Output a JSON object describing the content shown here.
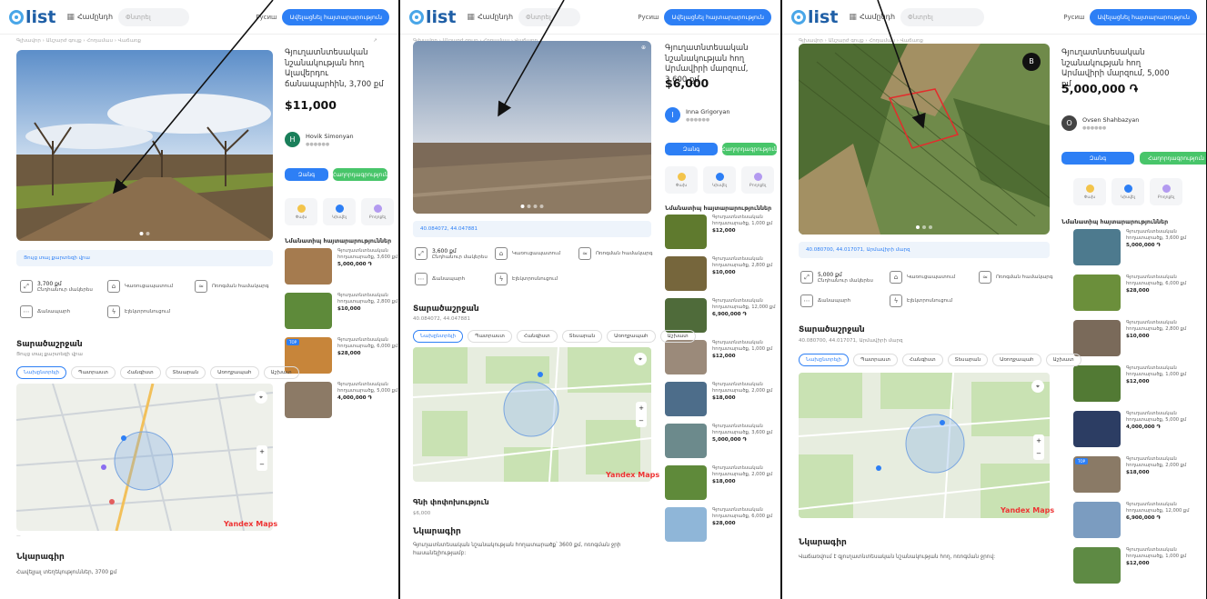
{
  "header": {
    "logo": "list",
    "category": "Համընդհ",
    "search_placeholder": "Փնտրել",
    "lang": "Русиш",
    "post_button": "Ավելացնել հայտարարություն"
  },
  "listings": [
    {
      "title": "Գյուղատնտեսական նշանակության հող Ալավերդու ճանապարհին, 3,700 քմ",
      "price": "$11,000",
      "seller_name": "Hovik Simonyan",
      "seller_initial": "H",
      "seller_color": "#1a7f5a",
      "coords": "Ցույց տալ քարտեզի վրա",
      "size": "3,700 քմ",
      "description": "Հավելյալ տեղեկություններ, 3700 քմ",
      "tabs": [
        "Նախընտրելի",
        "Պատրաստ",
        "Հանգիստ",
        "Տեսարան",
        "Առողջապահ",
        "Աշխատ"
      ]
    },
    {
      "title": "Գյուղատնտեսական նշանակության հող Արմավիրի մարզում, 3,600 քմ",
      "price": "$6,000",
      "seller_name": "Inna Grigoryan",
      "seller_initial": "I",
      "seller_color": "#2d7ff5",
      "coords": "40.084072, 44.047881",
      "size": "3,600 քմ",
      "price_history": "Գնի փոփոխություն",
      "description": "Գյուղատնտեսական նշանակության հողատարածք՝ 3600 քմ, ոռոգման ջրի հասանելիությամբ:",
      "tabs": [
        "Նախընտրելի",
        "Պատրաստ",
        "Հանգիստ",
        "Տեսարան",
        "Առողջապահ",
        "Աշխատ"
      ]
    },
    {
      "title": "Գյուղատնտեսական նշանակության հող Արմավիրի մարզում, 5,000 քմ",
      "price": "5,000,000 ֏",
      "seller_name": "Ovsen Shahbazyan",
      "seller_initial": "O",
      "seller_color": "#444",
      "coords": "40.080700, 44.017071, Արմավիրի մարզ",
      "size": "5,000 քմ",
      "description": "Վաճառվում է գյուղատնտեսական նշանակության հող, ոռոգման ջրով:",
      "tabs": [
        "Նախընտրելի",
        "Պատրաստ",
        "Հանգիստ",
        "Տեսարան",
        "Առողջապահ",
        "Աշխատ"
      ]
    }
  ],
  "labels": {
    "call": "Զանգ",
    "message": "Հաղորդագրություն",
    "similar": "Նմանատիպ հայտարարություններ",
    "location": "Տարածաշրջան",
    "desc_title": "Նկարագիր",
    "map_brand": "Yandex Maps",
    "act_save": "Փախ",
    "act_share": "Կիսվել",
    "act_report": "Բողոքել",
    "feat_area": "Ընդհանուր մակերես",
    "feat_build": "Կառուցապատում",
    "feat_irrig": "Ոռոգման համակարգ",
    "feat_road": "Ճանապարհ",
    "feat_elec": "Էլեկտրոսնուցում"
  },
  "similar": [
    [
      "Գյուղատնտեսական հողատարածք, 3,600 քմ",
      "5,000,000 ֏"
    ],
    [
      "Գյուղատնտեսական հողատարածք, 2,800 քմ",
      "$10,000"
    ],
    [
      "Գյուղատնտեսական հողատարածք, 6,000 քմ",
      "$28,000"
    ],
    [
      "Գյուղատնտեսական հողատարածք, 5,000 քմ",
      "4,000,000 ֏"
    ],
    [
      "Գյուղատնտեսական հողատարածք, 1,000 քմ",
      "$12,000"
    ],
    [
      "Գյուղատնտեսական հողատարածք, 2,000 քմ",
      "$18,000"
    ],
    [
      "Գյուղատնտեսական հողատարածք, 12,000 քմ",
      "6,900,000 ֏"
    ]
  ],
  "colors": {
    "accent": "#2d7ff5",
    "green": "#48c56a"
  }
}
